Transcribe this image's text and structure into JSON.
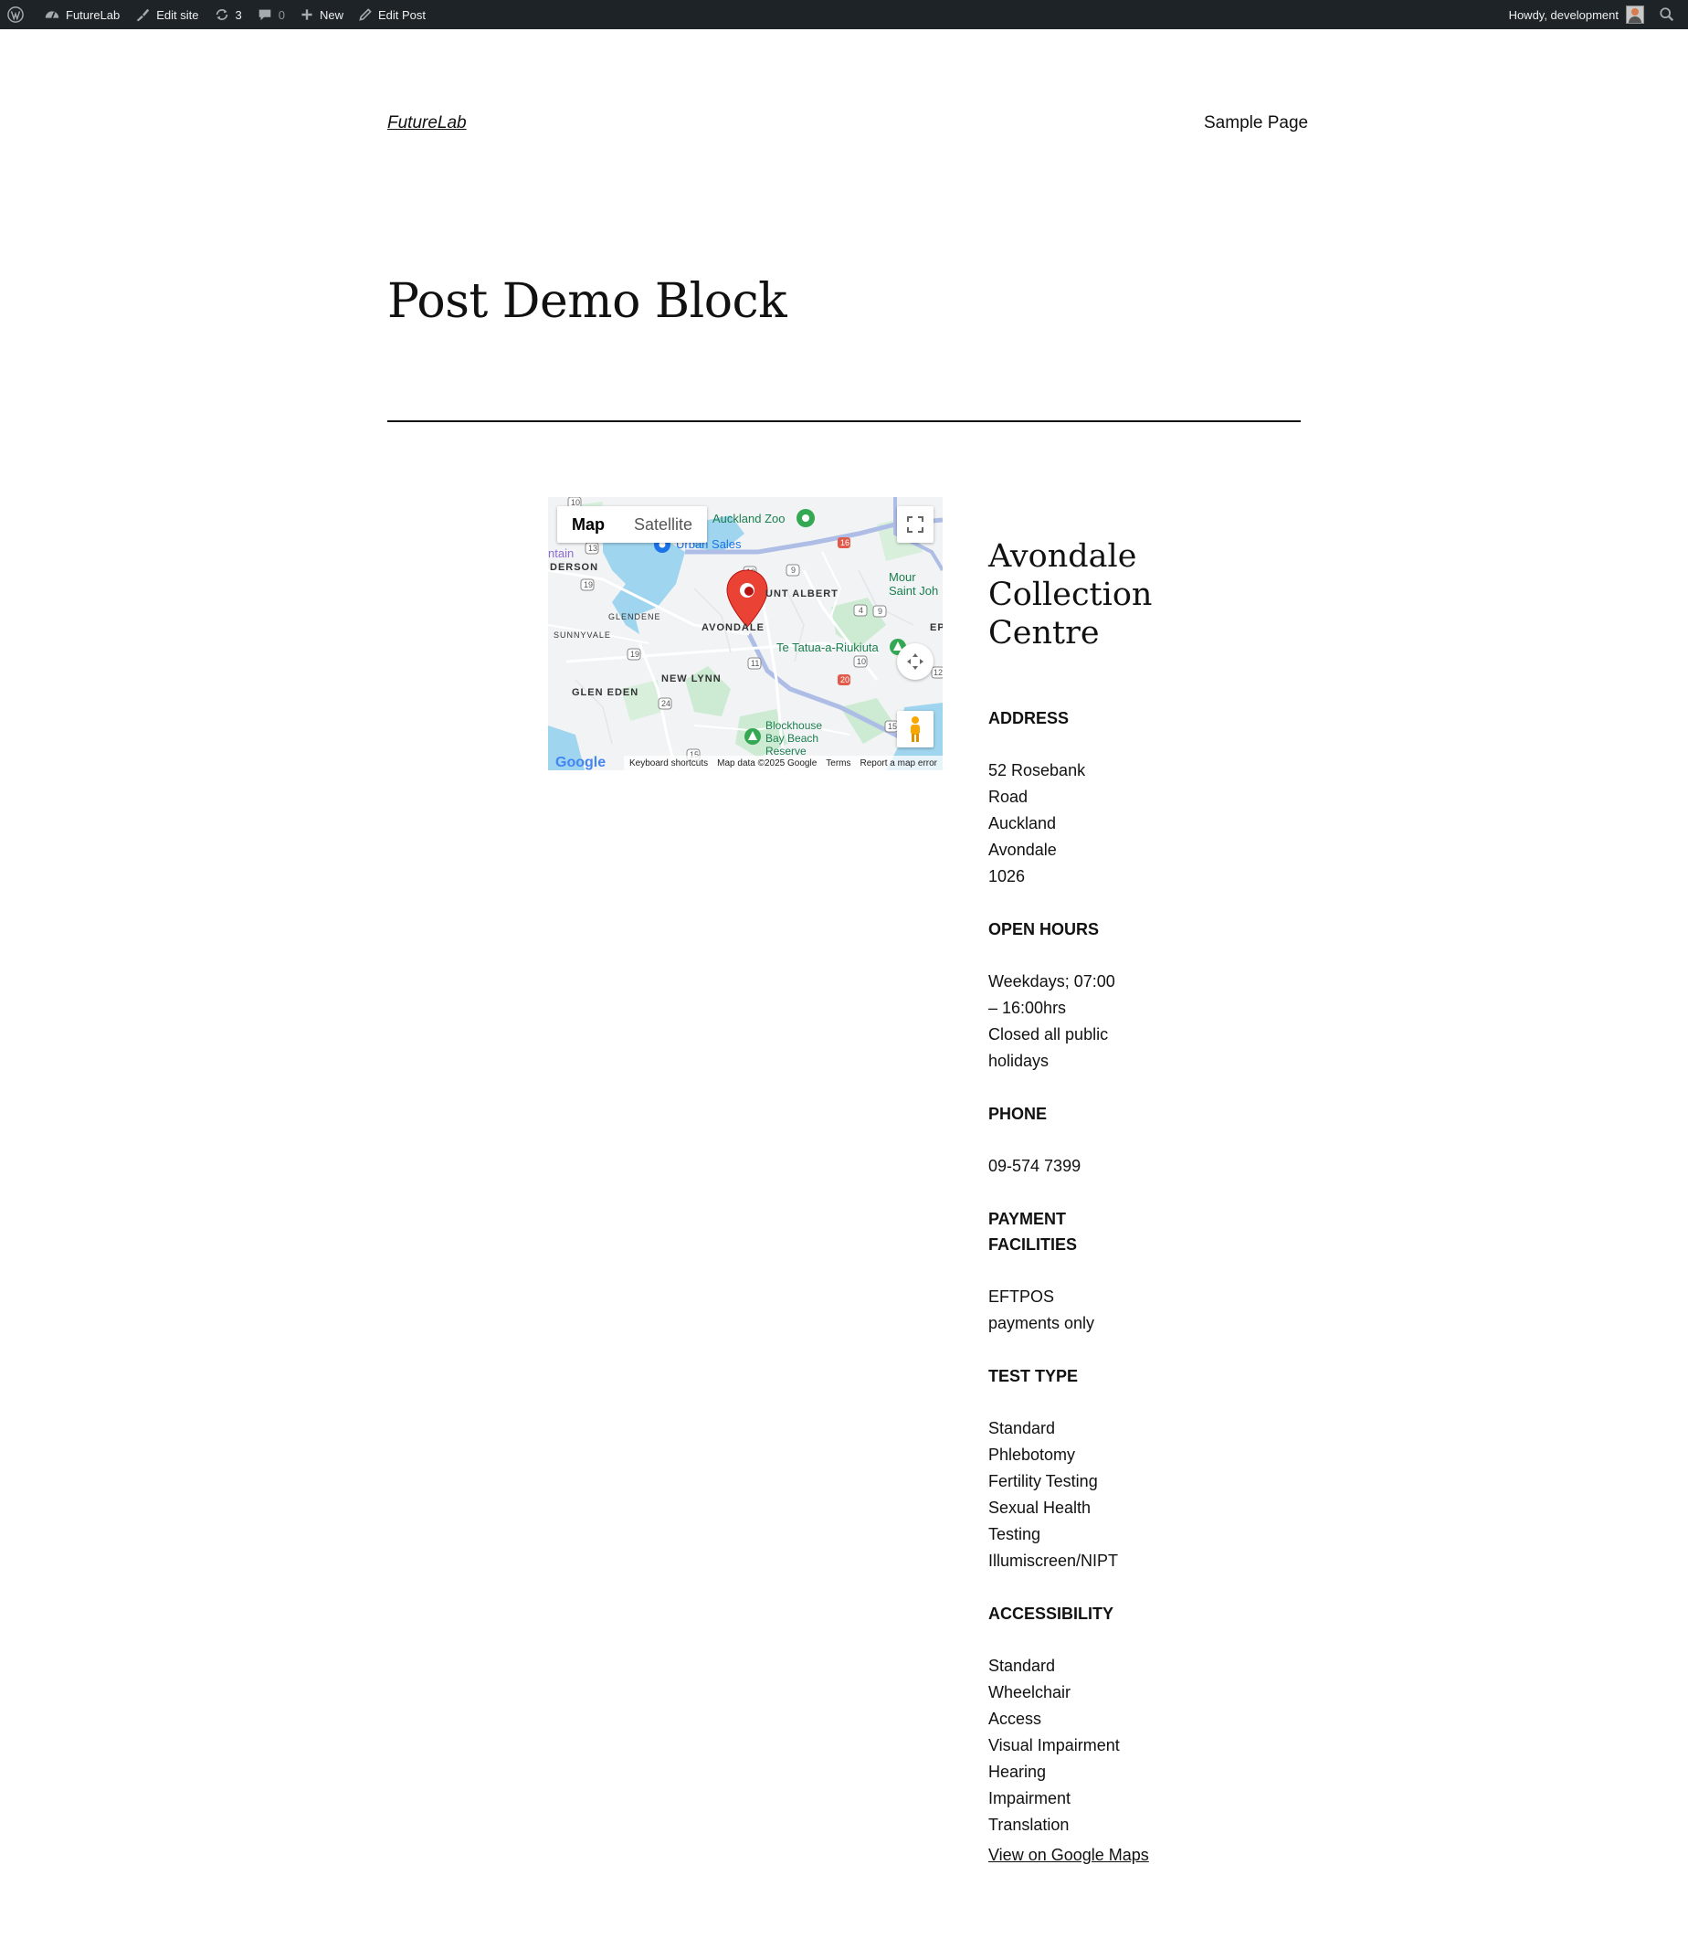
{
  "admin_bar": {
    "site_name": "FutureLab",
    "edit_site": "Edit site",
    "updates_count": "3",
    "comments_count": "0",
    "new_label": "New",
    "edit_post": "Edit Post",
    "howdy": "Howdy, development"
  },
  "header": {
    "site_title": "FutureLab",
    "nav_item": "Sample Page"
  },
  "post": {
    "title": "Post Demo Block"
  },
  "map": {
    "type_map": "Map",
    "type_satellite": "Satellite",
    "labels": {
      "auckland_zoo": "Auckland Zoo",
      "urban_sales": "Urban Sales",
      "mount_albert": "UNT ALBERT",
      "mount_saint_john": "Mour Saint Joh",
      "avondale": "AVONDALE",
      "glendene": "GLENDENE",
      "sunnyvale": "SUNNYVALE",
      "derson": "DERSON",
      "ntain": "ntain",
      "new_lynn": "NEW LYNN",
      "glen_eden": "GLEN EDEN",
      "te_tatua": "Te Tatua-a-Riukiuta",
      "blockhouse": "Blockhouse Bay Beach Reserve",
      "ep": "EP"
    },
    "footer": {
      "logo": "Google",
      "shortcuts": "Keyboard shortcuts",
      "map_data": "Map data ©2025 Google",
      "terms": "Terms",
      "report": "Report a map error"
    },
    "icons": [
      "fullscreen-icon",
      "camera-control-icon",
      "pegman-icon",
      "map-pin-icon"
    ]
  },
  "location": {
    "name": "Avondale Collection Centre",
    "address_heading": "ADDRESS",
    "address_lines": [
      "52 Rosebank",
      "Road",
      "Auckland",
      "Avondale",
      "1026"
    ],
    "hours_heading": "OPEN HOURS",
    "hours_lines": [
      "Weekdays; 07:00",
      "– 16:00hrs",
      "Closed all public",
      "holidays"
    ],
    "phone_heading": "PHONE",
    "phone": "09-574 7399",
    "payment_heading": "PAYMENT FACILITIES",
    "payment_lines": [
      "EFTPOS",
      "payments only"
    ],
    "test_heading": "TEST TYPE",
    "test_lines": [
      "Standard",
      "Phlebotomy",
      "Fertility Testing",
      "Sexual Health",
      "Testing",
      "Illumiscreen/NIPT"
    ],
    "access_heading": "ACCESSIBILITY",
    "access_lines": [
      "Standard",
      "Wheelchair",
      "Access",
      "Visual Impairment",
      "Hearing",
      "Impairment",
      "Translation"
    ],
    "google_maps_link": "View on Google Maps"
  }
}
